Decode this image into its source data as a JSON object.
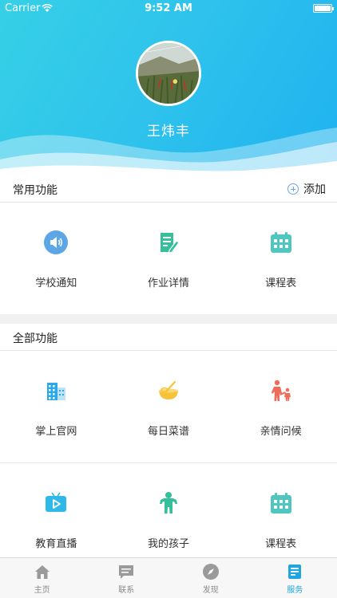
{
  "status_bar": {
    "carrier": "Carrier",
    "time": "9:52 AM"
  },
  "profile": {
    "name": "王炜丰"
  },
  "common_section": {
    "title": "常用功能",
    "add_label": "添加",
    "items": [
      {
        "label": "学校通知",
        "icon": "speaker-icon"
      },
      {
        "label": "作业详情",
        "icon": "homework-edit-icon"
      },
      {
        "label": "课程表",
        "icon": "calendar-icon"
      }
    ]
  },
  "all_section": {
    "title": "全部功能",
    "rows": [
      [
        {
          "label": "掌上官网",
          "icon": "building-icon"
        },
        {
          "label": "每日菜谱",
          "icon": "cooking-bowl-icon"
        },
        {
          "label": "亲情问候",
          "icon": "parent-child-icon"
        }
      ],
      [
        {
          "label": "教育直播",
          "icon": "tv-play-icon"
        },
        {
          "label": "我的孩子",
          "icon": "child-icon"
        },
        {
          "label": "课程表",
          "icon": "calendar-icon"
        }
      ]
    ]
  },
  "tab_bar": {
    "tabs": [
      {
        "label": "主页",
        "icon": "home-icon",
        "active": false
      },
      {
        "label": "联系",
        "icon": "message-icon",
        "active": false
      },
      {
        "label": "发现",
        "icon": "compass-icon",
        "active": false
      },
      {
        "label": "服务",
        "icon": "service-document-icon",
        "active": true
      }
    ]
  },
  "colors": {
    "header_start": "#36d0e6",
    "header_end": "#1fb2f0",
    "active_tab": "#1fa6e0"
  }
}
